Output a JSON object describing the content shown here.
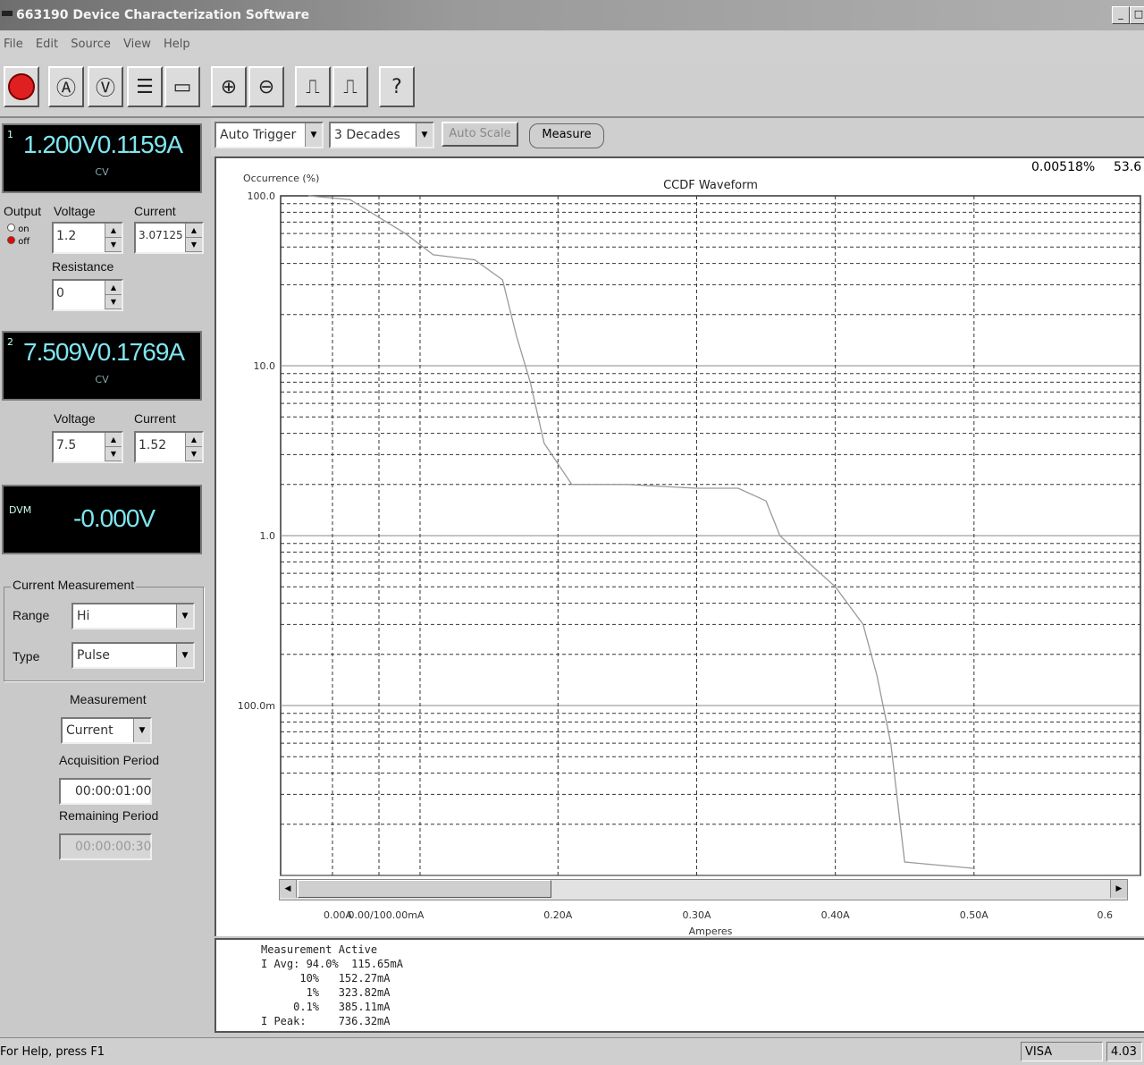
{
  "window": {
    "title": "663190 Device Characterization Software"
  },
  "menu": [
    "File",
    "Edit",
    "Source",
    "View",
    "Help"
  ],
  "toolbar": {
    "buttons": [
      "power-icon",
      "ammeter-icon",
      "voltmeter-icon",
      "list-icon",
      "waveform-icon",
      "zoom-in-icon",
      "zoom-out-icon",
      "trigger-pos-icon",
      "trigger-neg-icon",
      "help-icon"
    ]
  },
  "output1": {
    "channel": "1",
    "voltage": "1.200V",
    "current": "0.1159A",
    "mode": "CV",
    "output_label": "Output",
    "on_label": "on",
    "off_label": "off",
    "voltage_label": "Voltage",
    "current_label": "Current",
    "voltage_value": "1.2",
    "current_value": "3.07125",
    "resistance_label": "Resistance",
    "resistance_value": "0"
  },
  "output2": {
    "channel": "2",
    "voltage": "7.509V",
    "current": "0.1769A",
    "mode": "CV",
    "voltage_label": "Voltage",
    "current_label": "Current",
    "voltage_value": "7.5",
    "current_value": "1.52"
  },
  "dvm": {
    "label": "DVM",
    "value": "-0.000V"
  },
  "current_measurement": {
    "title": "Current Measurement",
    "range_label": "Range",
    "range_value": "Hi",
    "type_label": "Type",
    "type_value": "Pulse"
  },
  "measurement": {
    "label": "Measurement",
    "value": "Current",
    "acq_label": "Acquisition Period",
    "acq_value": "00:00:01:00",
    "remaining_label": "Remaining Period",
    "remaining_value": "00:00:00:30"
  },
  "chart_controls": {
    "trigger": "Auto Trigger",
    "decades": "3 Decades",
    "autoscale": "Auto Scale",
    "measure": "Measure"
  },
  "readout": {
    "percent": "0.00518%",
    "amps": "53.6"
  },
  "chart_data": {
    "type": "line",
    "title": "CCDF Waveform",
    "ylabel": "Occurrence (%)",
    "xlabel": "Amperes",
    "yscale": "log",
    "ylim": [
      0.01,
      100
    ],
    "xlim": [
      0,
      0.62
    ],
    "yticks": [
      "100.0",
      "10.0",
      "1.0",
      "100.0m"
    ],
    "xticks": [
      {
        "x": 0.0,
        "label": "0.00A"
      },
      {
        "x": 0.0,
        "label": "0.00/100.00mA"
      },
      {
        "x": 0.2,
        "label": "0.20A"
      },
      {
        "x": 0.3,
        "label": "0.30A"
      },
      {
        "x": 0.4,
        "label": "0.40A"
      },
      {
        "x": 0.5,
        "label": "0.50A"
      },
      {
        "x": 0.6,
        "label": "0.6"
      }
    ],
    "series": [
      {
        "name": "",
        "points": [
          [
            0.02,
            100
          ],
          [
            0.05,
            95
          ],
          [
            0.09,
            60
          ],
          [
            0.11,
            45
          ],
          [
            0.14,
            42
          ],
          [
            0.16,
            32
          ],
          [
            0.17,
            15
          ],
          [
            0.18,
            8
          ],
          [
            0.19,
            3.5
          ],
          [
            0.21,
            2.0
          ],
          [
            0.25,
            2.0
          ],
          [
            0.3,
            1.9
          ],
          [
            0.33,
            1.9
          ],
          [
            0.35,
            1.6
          ],
          [
            0.36,
            1.0
          ],
          [
            0.38,
            0.7
          ],
          [
            0.4,
            0.5
          ],
          [
            0.42,
            0.3
          ],
          [
            0.43,
            0.15
          ],
          [
            0.44,
            0.06
          ],
          [
            0.45,
            0.012
          ],
          [
            0.5,
            0.011
          ]
        ]
      }
    ]
  },
  "measurement_results": {
    "title": "Measurement Active",
    "lines": [
      "I Avg: 94.0%  115.65mA",
      "      10%   152.27mA",
      "       1%   323.82mA",
      "     0.1%   385.11mA",
      "I Peak:     736.32mA"
    ]
  },
  "status": {
    "help": "For Help, press F1",
    "visa": "VISA",
    "version": "4.03"
  }
}
